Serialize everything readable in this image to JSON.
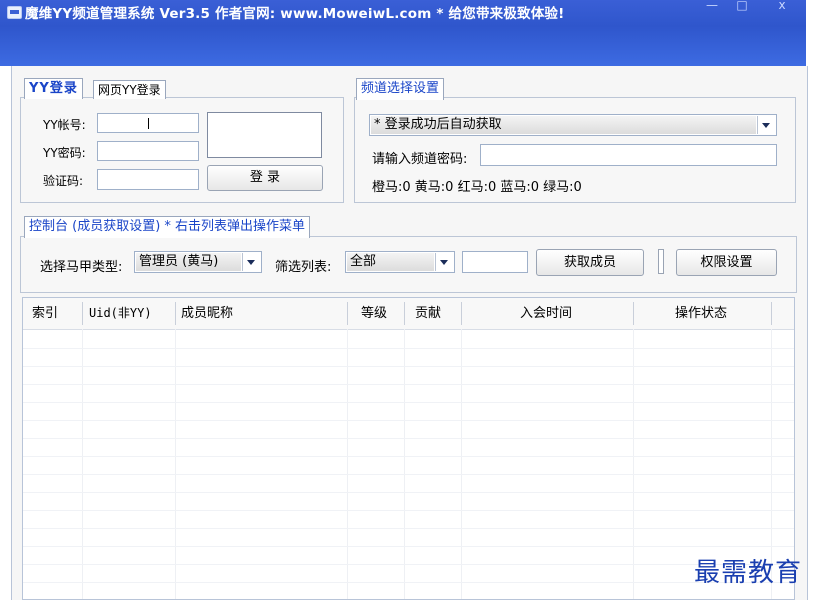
{
  "window": {
    "title": "魔维YY频道管理系统 Ver3.5  作者官网: www.MoweiwL.com  *  给您带来极致体验!",
    "controls": [
      "—",
      "□",
      "x"
    ]
  },
  "login": {
    "tabs": [
      {
        "label": "YY登录",
        "active": true
      },
      {
        "label": "网页YY登录",
        "active": false
      }
    ],
    "account_label": "YY帐号:",
    "password_label": "YY密码:",
    "captcha_label": "验证码:",
    "account_value": "",
    "password_value": "",
    "captcha_value": "",
    "login_button": "登 录"
  },
  "channel": {
    "tab": "频道选择设置",
    "select_value": "* 登录成功后自动获取",
    "password_label": "请输入频道密码:",
    "password_value": "",
    "stats": "橙马:0 黄马:0 红马:0 蓝马:0 绿马:0"
  },
  "console": {
    "tab": "控制台 (成员获取设置) * 右击列表弹出操作菜单",
    "type_label": "选择马甲类型:",
    "type_value": "管理员 (黄马)",
    "filter_label": "筛选列表:",
    "filter_value": "全部",
    "get_members_button": "获取成员",
    "permissions_button": "权限设置"
  },
  "table": {
    "columns": [
      "索引",
      "Uid(非YY)",
      "成员昵称",
      "等级",
      "贡献",
      "入会时间",
      "操作状态"
    ],
    "rows": []
  },
  "watermark": "最需教育",
  "colors": {
    "title_bar": "#3a5fd6",
    "active_tab_text": "#1a45c8",
    "watermark": "#1a3fb0"
  }
}
